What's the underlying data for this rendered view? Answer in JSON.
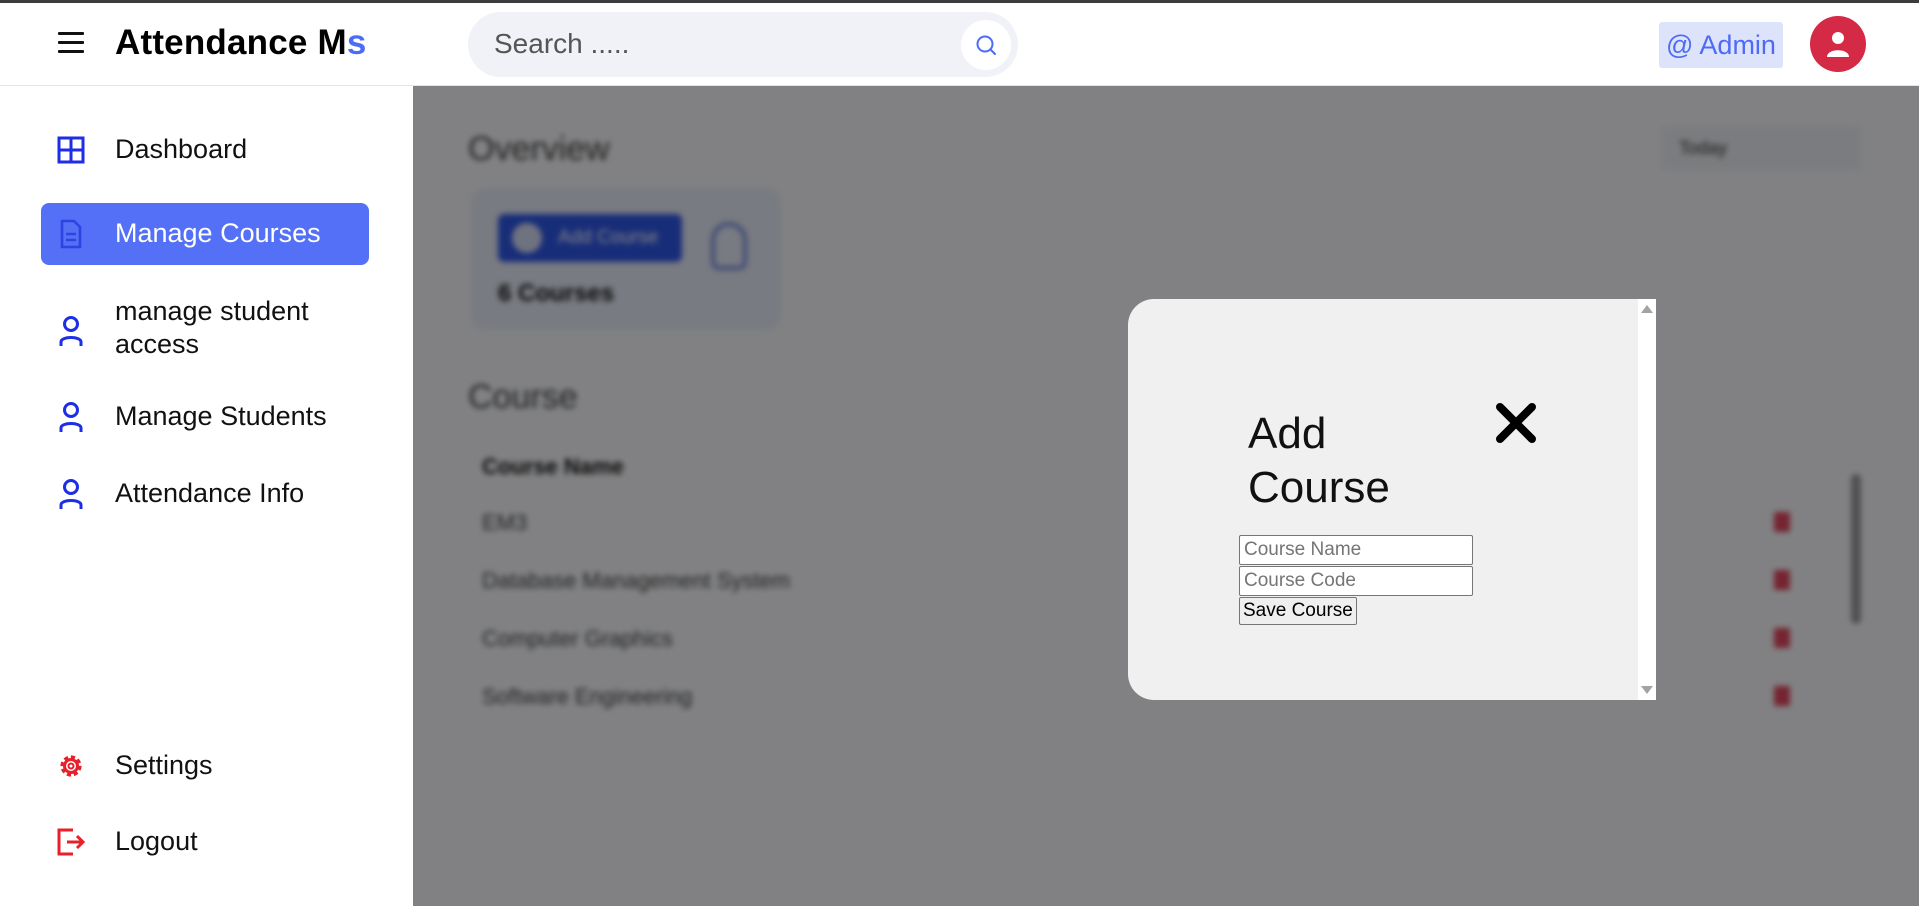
{
  "header": {
    "brand_main": "Attendance M",
    "brand_accent": "s",
    "search_placeholder": "Search .....",
    "admin_label": "@ Admin"
  },
  "sidebar": {
    "items": [
      {
        "label": "Dashboard",
        "icon": "grid-icon",
        "active": false
      },
      {
        "label": "Manage Courses",
        "icon": "document-icon",
        "active": true
      },
      {
        "label": "manage student access",
        "icon": "user-icon",
        "active": false
      },
      {
        "label": "Manage Students",
        "icon": "user-icon",
        "active": false
      },
      {
        "label": "Attendance Info",
        "icon": "user-icon",
        "active": false
      }
    ],
    "bottom_items": [
      {
        "label": "Settings",
        "icon": "gear-icon"
      },
      {
        "label": "Logout",
        "icon": "logout-icon"
      }
    ]
  },
  "background": {
    "overview_title": "Overview",
    "range_select": "Today",
    "add_course_button": "Add Course",
    "course_count": "6 Courses",
    "course_section_title": "Course",
    "table_header_name": "Course Name",
    "rows": [
      {
        "name": "EM3"
      },
      {
        "name": "Database Management System"
      },
      {
        "name": "Computer Graphics"
      },
      {
        "name": "Software Engineering"
      }
    ]
  },
  "modal": {
    "title": "Add Course",
    "course_name_placeholder": "Course Name",
    "course_code_placeholder": "Course Code",
    "save_label": "Save Course"
  },
  "colors": {
    "accent": "#4d6bf5",
    "active_nav": "#5470f6",
    "icon_blue": "#1d2ee6",
    "icon_red": "#e8202a",
    "avatar": "#d42a45"
  }
}
